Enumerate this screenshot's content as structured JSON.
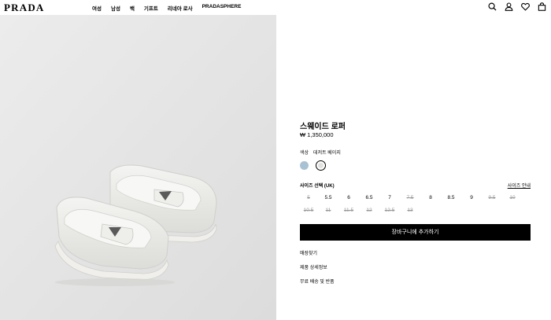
{
  "brand": "PRADA",
  "nav": [
    "여성",
    "남성",
    "백",
    "기프트",
    "리네아 로사",
    "PRADASPHERE"
  ],
  "header_icons": [
    "search-icon",
    "user-icon",
    "heart-icon",
    "bag-icon"
  ],
  "product": {
    "title": "스웨이드 로퍼",
    "price": "₩ 1,350,000",
    "color_label": "색상",
    "color_value": "데저트 베이지",
    "swatches": [
      "#a9c2d3",
      "#e2e1dc"
    ],
    "size_label": "사이즈 선택 (UK)",
    "size_guide": "사이즈 안내",
    "sizes_row1": [
      {
        "label": "5",
        "available": false
      },
      {
        "label": "5.5",
        "available": true
      },
      {
        "label": "6",
        "available": true
      },
      {
        "label": "6.5",
        "available": true
      },
      {
        "label": "7",
        "available": true
      },
      {
        "label": "7.5",
        "available": false
      },
      {
        "label": "8",
        "available": true
      },
      {
        "label": "8.5",
        "available": true
      },
      {
        "label": "9",
        "available": true
      },
      {
        "label": "9.5",
        "available": false
      },
      {
        "label": "10",
        "available": false
      }
    ],
    "sizes_row2": [
      {
        "label": "10.5",
        "available": false
      },
      {
        "label": "11",
        "available": false
      },
      {
        "label": "11.5",
        "available": false
      },
      {
        "label": "12",
        "available": false
      },
      {
        "label": "12.5",
        "available": false
      },
      {
        "label": "13",
        "available": false
      }
    ],
    "add_to_cart": "장바구니에 추가하기",
    "links": [
      "매장찾기",
      "제품 상세정보",
      "무료 배송 및 반품"
    ]
  }
}
